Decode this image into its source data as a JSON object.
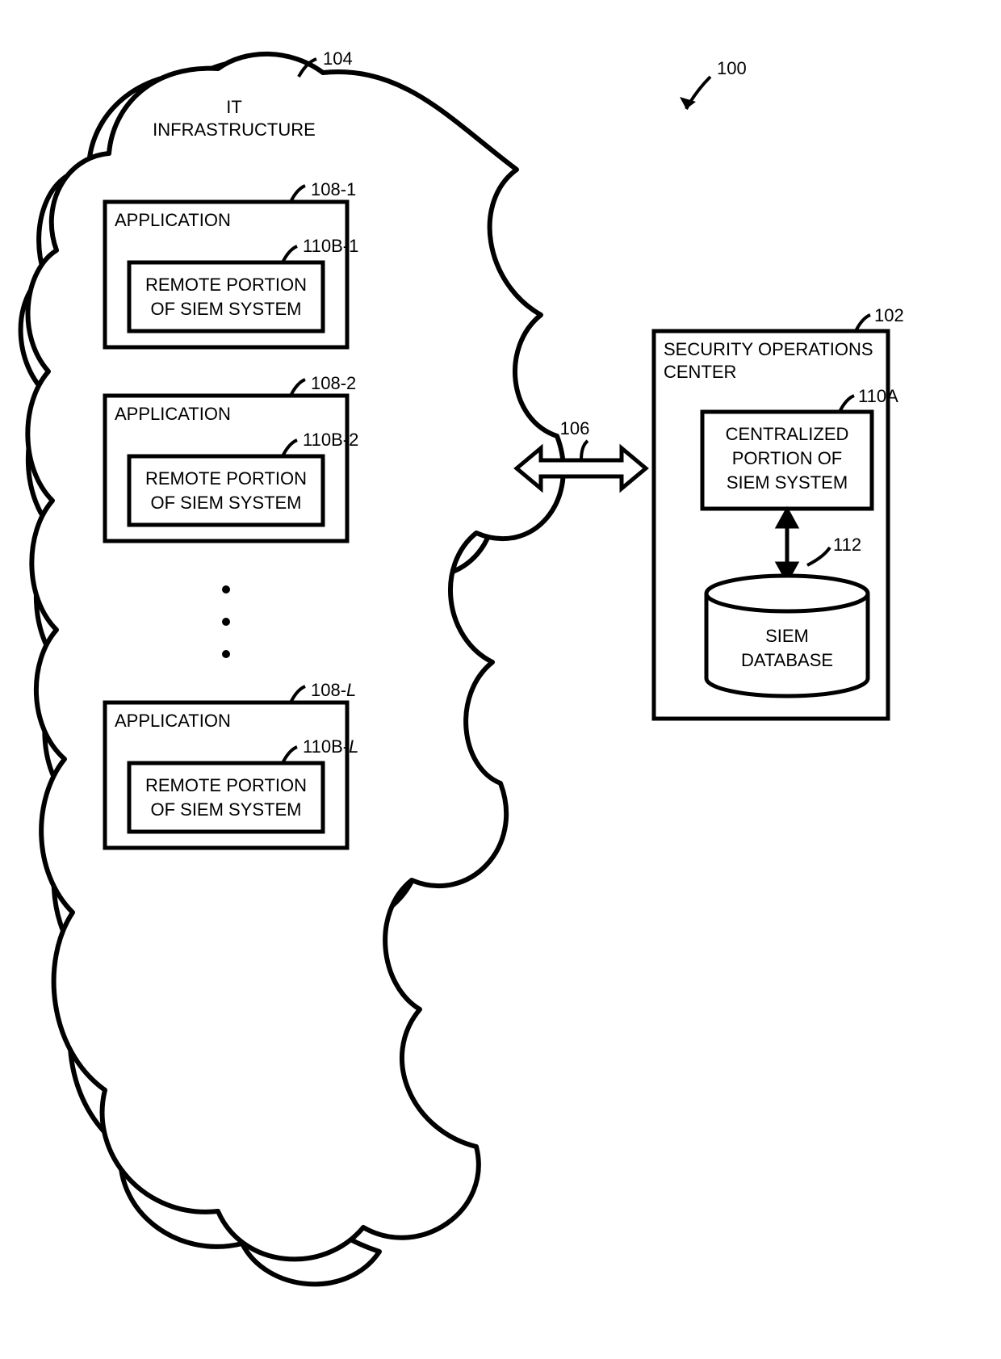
{
  "figure": {
    "ref_100": "100",
    "ref_104": "104",
    "ref_106": "106",
    "ref_102": "102",
    "ref_110A": "110A",
    "ref_112": "112",
    "cloud_title_l1": "IT",
    "cloud_title_l2": "INFRASTRUCTURE",
    "soc_title_l1": "SECURITY OPERATIONS",
    "soc_title_l2": "CENTER",
    "centralized_l1": "CENTRALIZED",
    "centralized_l2": "PORTION OF",
    "centralized_l3": "SIEM SYSTEM",
    "db_l1": "SIEM",
    "db_l2": "DATABASE",
    "apps": [
      {
        "ref": "108-1",
        "ref_inner": "110B-1",
        "title": "APPLICATION",
        "inner_l1": "REMOTE PORTION",
        "inner_l2": "OF SIEM SYSTEM",
        "ref_suffix_italic": ""
      },
      {
        "ref": "108-2",
        "ref_inner": "110B-2",
        "title": "APPLICATION",
        "inner_l1": "REMOTE PORTION",
        "inner_l2": "OF SIEM SYSTEM",
        "ref_suffix_italic": ""
      },
      {
        "ref": "108-",
        "ref_inner": "110B-",
        "title": "APPLICATION",
        "inner_l1": "REMOTE PORTION",
        "inner_l2": "OF SIEM SYSTEM",
        "ref_suffix_italic": "L"
      }
    ]
  }
}
